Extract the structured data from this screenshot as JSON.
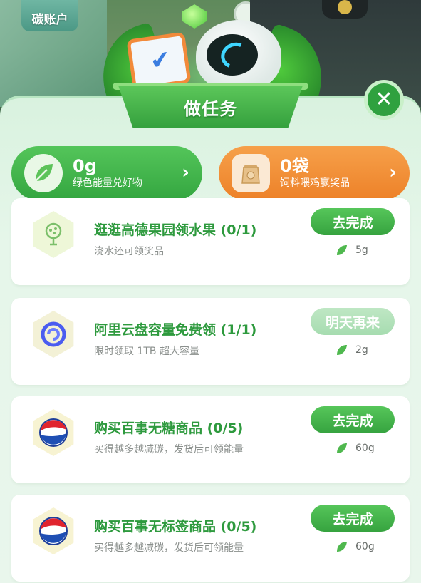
{
  "header": {
    "account_label": "碳账户",
    "title": "做任务"
  },
  "rewards": [
    {
      "value": "0g",
      "desc": "绿色能量兑好物",
      "icon": "leaf-icon",
      "color": "#3fb44a"
    },
    {
      "value": "0袋",
      "desc": "饲料喂鸡赢奖品",
      "icon": "feed-bag-icon",
      "color": "#f08d32"
    }
  ],
  "tasks": [
    {
      "title": "逛逛高德果园领水果 (0/1)",
      "subtitle": "浇水还可领奖品",
      "button": "去完成",
      "reward": "5g",
      "icon": "tree-icon",
      "completed": false
    },
    {
      "title": "阿里云盘容量免费领 (1/1)",
      "subtitle": "限时领取 1TB 超大容量",
      "button": "明天再来",
      "reward": "2g",
      "icon": "aliyun-drive-icon",
      "completed": true
    },
    {
      "title": "购买百事无糖商品 (0/5)",
      "subtitle": "买得越多越减碳，发货后可领能量",
      "button": "去完成",
      "reward": "60g",
      "icon": "pepsi-icon",
      "completed": false
    },
    {
      "title": "购买百事无标签商品 (0/5)",
      "subtitle": "买得越多越减碳，发货后可领能量",
      "button": "去完成",
      "reward": "60g",
      "icon": "pepsi-icon",
      "completed": false
    }
  ],
  "colors": {
    "accent_green": "#34a640",
    "orange": "#ed8128",
    "panel_bg": "#e6f6ea",
    "title_green": "#2e9a3e"
  }
}
